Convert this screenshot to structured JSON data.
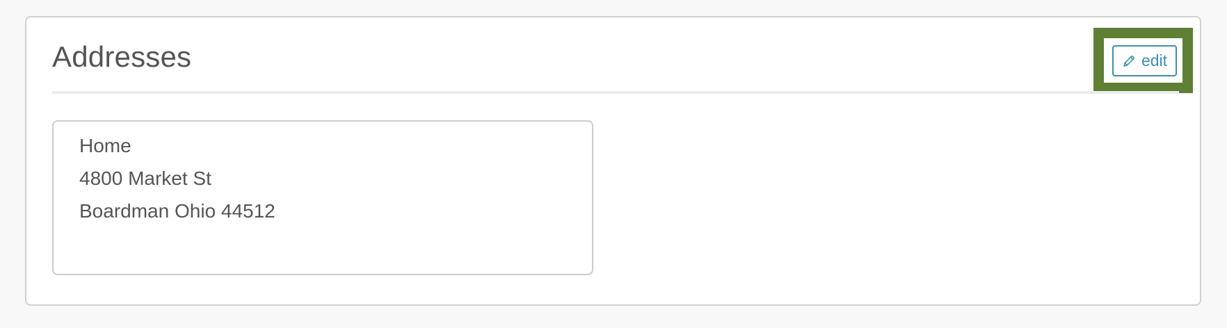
{
  "panel": {
    "title": "Addresses",
    "edit_button": {
      "label": "edit",
      "icon": "pencil-icon"
    },
    "highlight_color": "#5e7f34",
    "accent_color": "#3c8fb0"
  },
  "addresses": [
    {
      "label": "Home",
      "street": "4800 Market St",
      "city_state_zip": "Boardman Ohio 44512"
    }
  ]
}
